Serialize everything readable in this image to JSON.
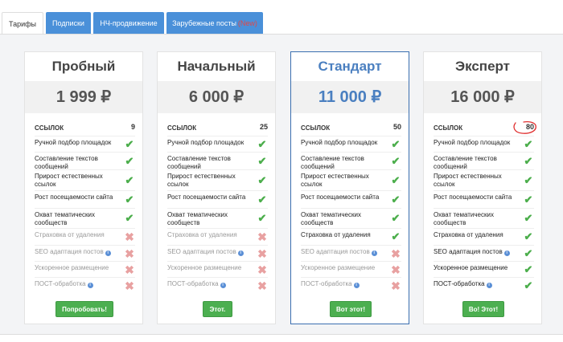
{
  "tabs": [
    {
      "label": "Тарифы",
      "active": true
    },
    {
      "label": "Подписки"
    },
    {
      "label": "НЧ-продвижение"
    },
    {
      "label": "Зарубежные посты",
      "badge": "(New)"
    }
  ],
  "colors": {
    "tab_blue": "#4a90d9",
    "featured_border": "#3b6fb0",
    "button_green": "#4caf50",
    "check_green": "#4cae4c",
    "cross_pink": "#e8a1a1",
    "scribble_red": "#e03030"
  },
  "feature_labels": {
    "links": "ССЫЛОК",
    "manual": "Ручной подбор площадок",
    "texts": "Составление текстов сообщений",
    "natural": "Прирост естественных ссылок",
    "traffic": "Рост посещаемости сайта",
    "thematic": "Охват тематических сообществ",
    "insurance": "Страховка от удаления",
    "seo": "SEO адаптация постов",
    "fast": "Ускоренное размещение",
    "post": "ПОСТ-обработка"
  },
  "plans": [
    {
      "name": "Пробный",
      "price": "1 999 ₽",
      "links": "9",
      "button": "Попробовать!",
      "features": {
        "manual": true,
        "texts": true,
        "natural": true,
        "traffic": true,
        "thematic": true,
        "insurance": false,
        "seo": false,
        "fast": false,
        "post": false
      }
    },
    {
      "name": "Начальный",
      "price": "6 000 ₽",
      "links": "25",
      "button": "Этот.",
      "features": {
        "manual": true,
        "texts": true,
        "natural": true,
        "traffic": true,
        "thematic": true,
        "insurance": false,
        "seo": false,
        "fast": false,
        "post": false
      }
    },
    {
      "name": "Стандарт",
      "price": "11 000 ₽",
      "links": "50",
      "button": "Вот этот!",
      "featured": true,
      "features": {
        "manual": true,
        "texts": true,
        "natural": true,
        "traffic": true,
        "thematic": true,
        "insurance": true,
        "seo": false,
        "fast": false,
        "post": false
      }
    },
    {
      "name": "Эксперт",
      "price": "16 000 ₽",
      "links": "80",
      "button": "Во! Этот!",
      "features": {
        "manual": true,
        "texts": true,
        "natural": true,
        "traffic": true,
        "thematic": true,
        "insurance": true,
        "seo": true,
        "fast": true,
        "post": true
      }
    }
  ],
  "icons": {
    "check": "check-icon",
    "cross": "cross-icon",
    "info": "info-icon"
  }
}
